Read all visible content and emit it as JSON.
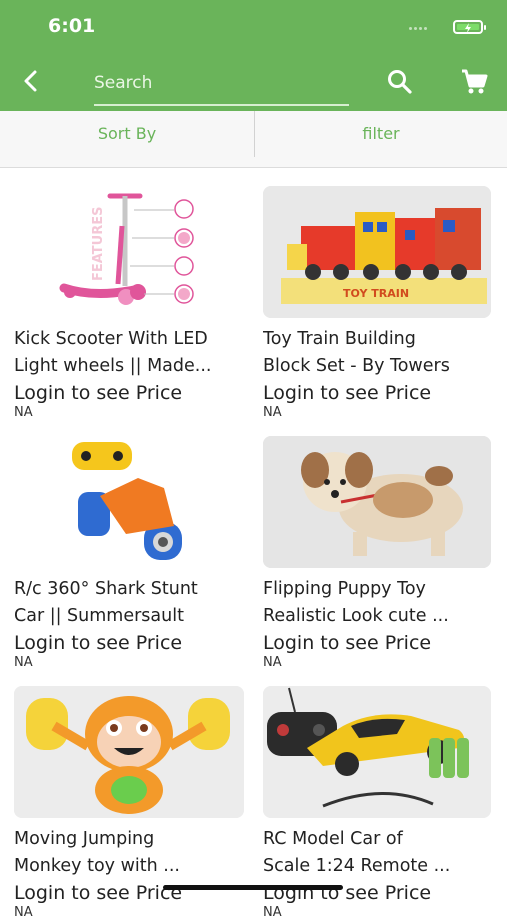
{
  "status": {
    "time": "6:01"
  },
  "header": {
    "search_placeholder": "Search"
  },
  "toolbar": {
    "sort_label": "Sort By",
    "filter_label": "filter"
  },
  "products": [
    {
      "title_line1": "Kick Scooter With LED",
      "title_line2": "Light wheels || Made...",
      "price_text": "Login to see Price",
      "na": "NA"
    },
    {
      "title_line1": "Toy Train Building",
      "title_line2": "Block Set - By Towers",
      "price_text": "Login to see Price",
      "na": "NA"
    },
    {
      "title_line1": "R/c 360° Shark Stunt",
      "title_line2": "Car || Summersault",
      "price_text": "Login to see Price",
      "na": "NA"
    },
    {
      "title_line1": "Flipping Puppy Toy",
      "title_line2": "Realistic Look cute ...",
      "price_text": "Login to see Price",
      "na": "NA"
    },
    {
      "title_line1": "Moving Jumping",
      "title_line2": "Monkey toy with ...",
      "price_text": "Login to see Price",
      "na": "NA"
    },
    {
      "title_line1": "RC Model Car of",
      "title_line2": "Scale 1:24 Remote ...",
      "price_text": "Login to see Price",
      "na": "NA"
    }
  ],
  "images": {
    "scooter_features_text": "FEATURES",
    "train_box_text": "TOY TRAIN"
  },
  "colors": {
    "accent": "#6ab45a"
  }
}
